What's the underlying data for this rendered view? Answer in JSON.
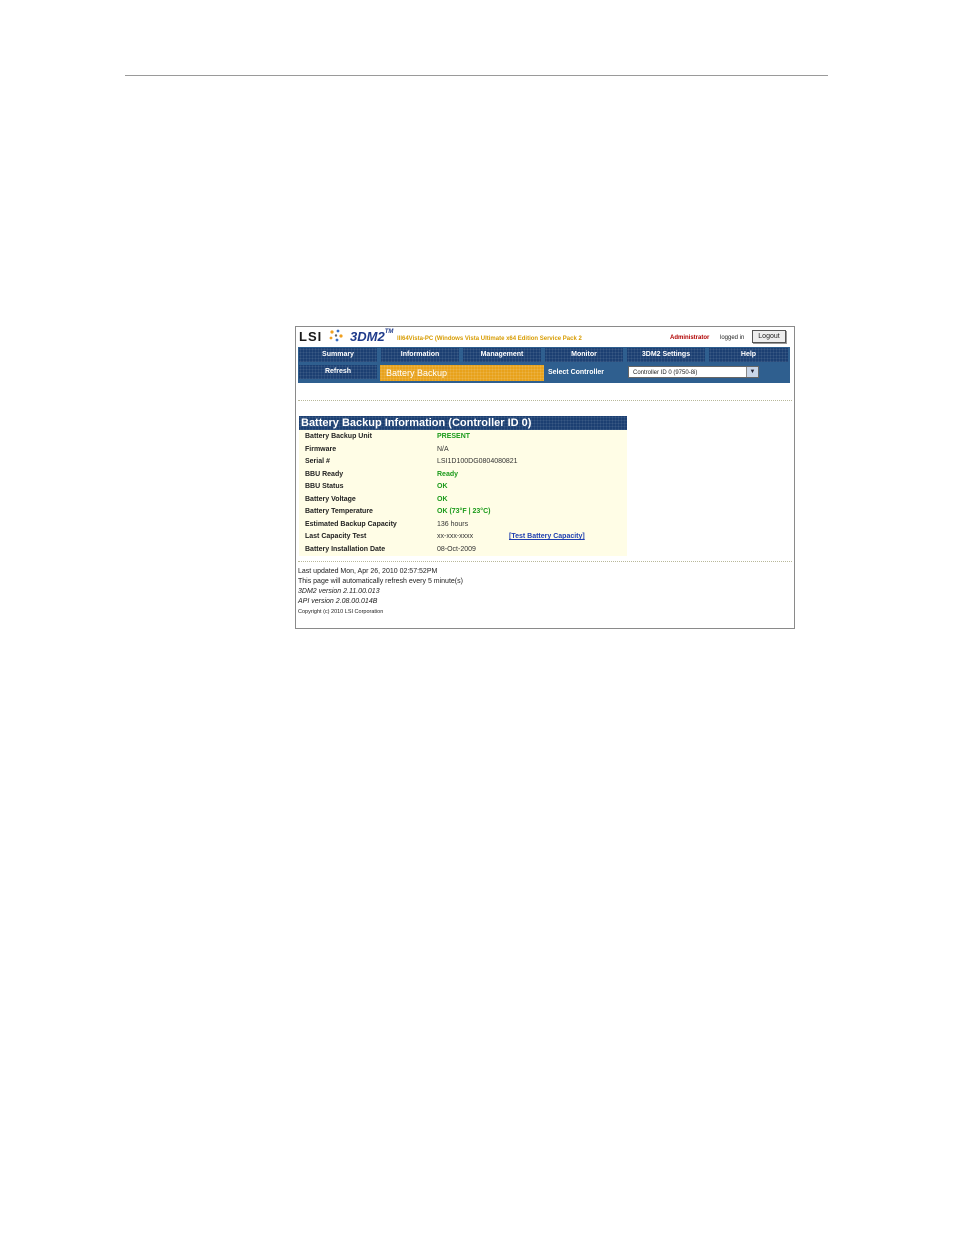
{
  "header": {
    "logo": "LSI",
    "product": "3DM2",
    "trademark": "TM",
    "host": "lll64Vista-PC (Windows Vista Ultimate x64 Edition Service Pack 2",
    "user_role": "Administrator",
    "logged_in": "logged in",
    "logout_label": "Logout"
  },
  "nav": {
    "tabs": [
      "Summary",
      "Information",
      "Management",
      "Monitor",
      "3DM2 Settings",
      "Help"
    ],
    "refresh_label": "Refresh",
    "current_page": "Battery Backup",
    "select_label": "Select Controller",
    "controller_selected": "Controller ID 0 (9750-8i)"
  },
  "panel": {
    "title": "Battery Backup Information (Controller ID 0)",
    "rows": [
      {
        "label": "Battery Backup Unit",
        "value": "PRESENT"
      },
      {
        "label": "Firmware",
        "value": "N/A"
      },
      {
        "label": "Serial #",
        "value": "LSI1D100DG0804080821"
      },
      {
        "label": "BBU Ready",
        "value": "Ready"
      },
      {
        "label": "BBU Status",
        "value": "OK"
      },
      {
        "label": "Battery Voltage",
        "value": "OK"
      },
      {
        "label": "Battery Temperature",
        "value": "OK (73°F | 23°C)"
      },
      {
        "label": "Estimated Backup Capacity",
        "value": "136 hours"
      },
      {
        "label": "Last Capacity Test",
        "value": "xx-xxx-xxxx"
      },
      {
        "label": "Battery Installation Date",
        "value": "08-Oct-2009"
      }
    ],
    "test_link": "[Test Battery Capacity]"
  },
  "footer": {
    "updated": "Last updated Mon, Apr 26, 2010 02:57:52PM",
    "refresh_note": "This page will automatically refresh every 5 minute(s)",
    "version_3dm2": "3DM2 version 2.11.00.013",
    "version_api": "API version 2.08.00.014B",
    "copyright": "Copyright (c) 2010 LSI Corporation"
  },
  "colors": {
    "nav_dark": "#1c3f72",
    "nav_bar": "#2f5f8f",
    "active_tab": "#e8a21b",
    "ok_green": "#1a9a1a",
    "admin_red": "#b00000"
  }
}
